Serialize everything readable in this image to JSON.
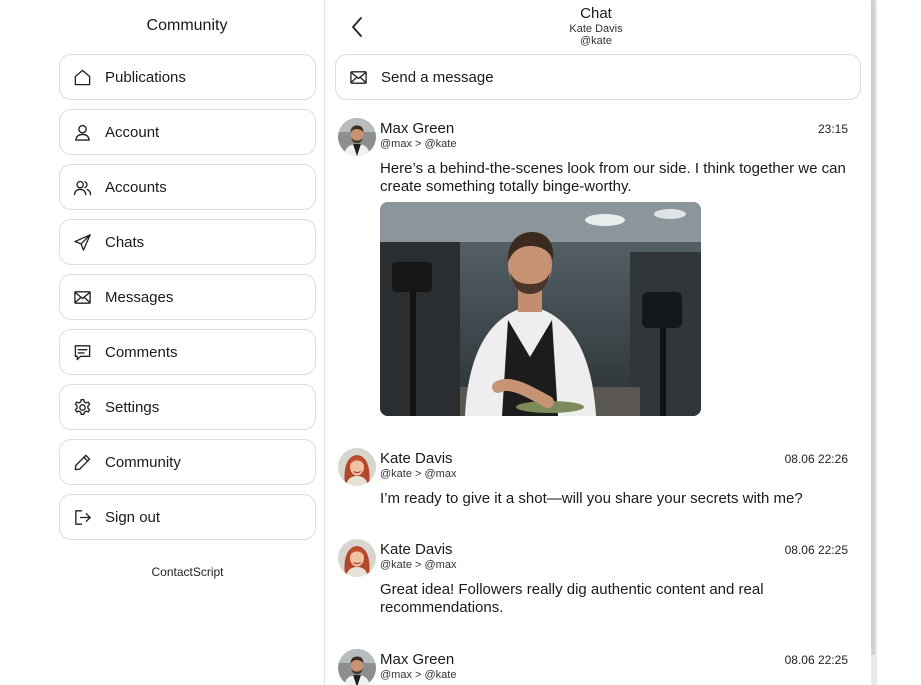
{
  "sidebar": {
    "title": "Community",
    "items": [
      {
        "label": "Publications",
        "icon": "home-icon"
      },
      {
        "label": "Account",
        "icon": "user-icon"
      },
      {
        "label": "Accounts",
        "icon": "users-icon"
      },
      {
        "label": "Chats",
        "icon": "send-icon"
      },
      {
        "label": "Messages",
        "icon": "mail-icon"
      },
      {
        "label": "Comments",
        "icon": "comment-icon"
      },
      {
        "label": "Settings",
        "icon": "gear-icon"
      },
      {
        "label": "Community",
        "icon": "pencil-icon"
      },
      {
        "label": "Sign out",
        "icon": "sign-out-icon"
      }
    ],
    "brand": "ContactScript"
  },
  "chat": {
    "title": "Chat",
    "contact_name": "Kate Davis",
    "contact_handle": "@kate",
    "send_placeholder": "Send a message",
    "messages": [
      {
        "author": "Max Green",
        "route": "@max > @kate",
        "time": "23:15",
        "text": "Here’s a behind-the-scenes look from our side. I think together we can create something totally binge-worthy.",
        "has_image": true
      },
      {
        "author": "Kate Davis",
        "route": "@kate > @max",
        "time": "08.06 22:26",
        "text": "I’m ready to give it a shot—will you share your secrets with me?"
      },
      {
        "author": "Kate Davis",
        "route": "@kate > @max",
        "time": "08.06 22:25",
        "text": "Great idea! Followers really dig authentic content and real recommendations."
      },
      {
        "author": "Max Green",
        "route": "@max > @kate",
        "time": "08.06 22:25",
        "text": ""
      }
    ]
  }
}
